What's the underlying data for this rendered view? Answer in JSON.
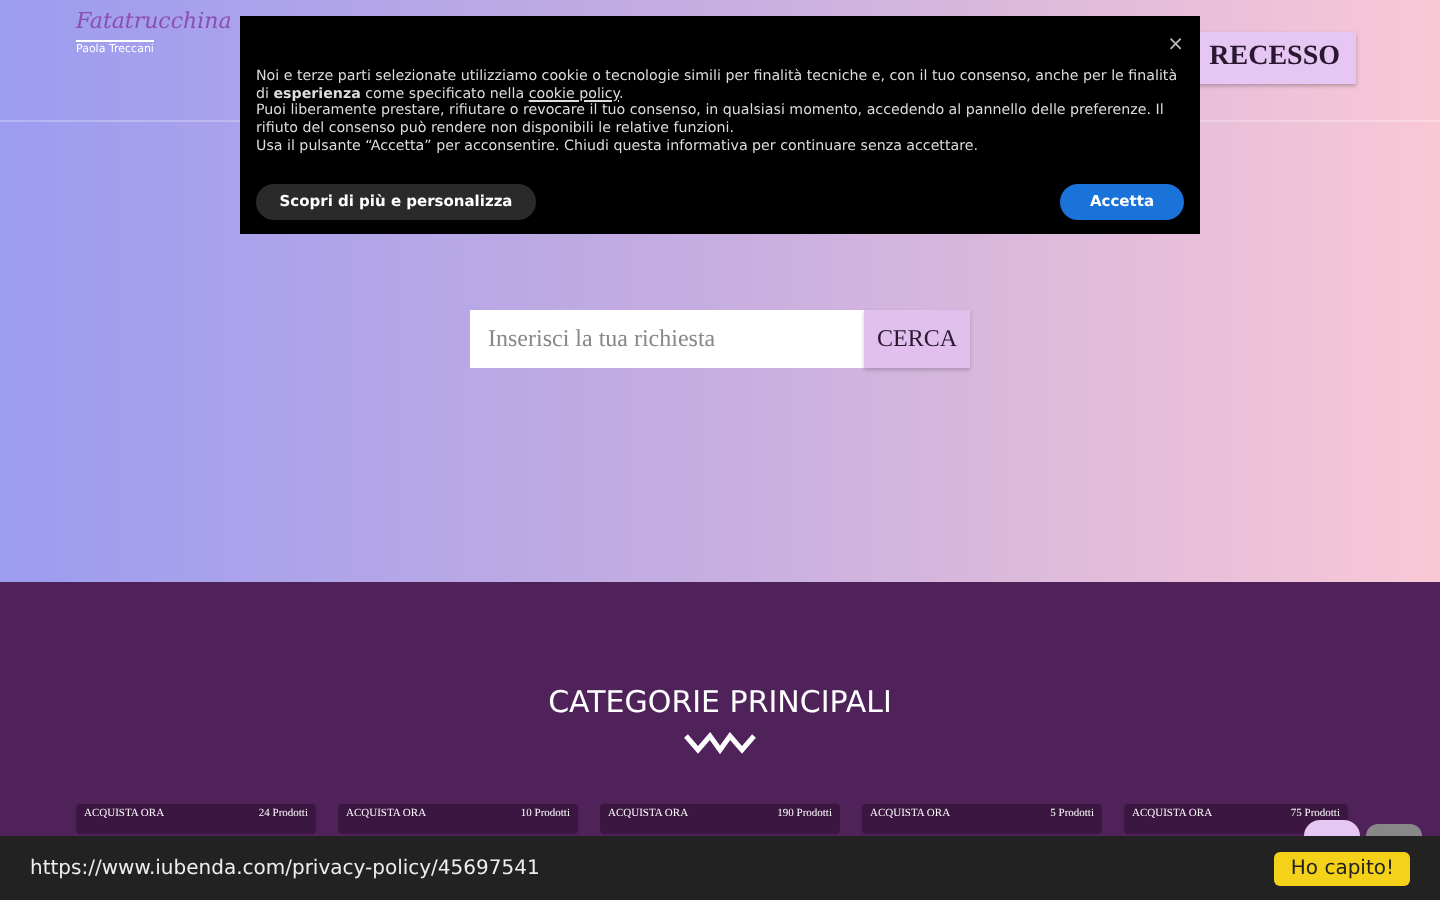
{
  "header": {
    "logo": "Fatatrucchina",
    "logo_subtitle": "Paola Treccani",
    "recesso_button": "RECESSO"
  },
  "cookie_banner": {
    "close": "×",
    "paragraph_1": {
      "before": "Noi e terze parti selezionate utilizziamo cookie o tecnologie simili per finalità tecniche e, con il tuo consenso, anche per le finalità di **esperienza** come specificato nella ",
      "link": "cookie policy",
      "after": "."
    },
    "paragraph_2": "Puoi liberamente prestare, rifiutare o revocare il tuo consenso, in qualsiasi momento, accedendo al pannello delle preferenze. Il rifiuto del consenso può rendere non disponibili le relative funzioni.",
    "paragraph_3": "Usa il pulsante “Accetta” per acconsentire. Chiudi questa informativa per continuare senza accettare.",
    "buttons": [
      {
        "label": "Scopri di più e personalizza",
        "kind": "secondary"
      },
      {
        "label": "Accetta",
        "kind": "primary"
      }
    ]
  },
  "search": {
    "placeholder": "Inserisci la tua richiesta",
    "button": "CERCA"
  },
  "categories": {
    "title": "CATEGORIE PRINCIPALI",
    "cards": [
      {
        "action": "ACQUISTA ORA",
        "count": "24 Prodotti"
      },
      {
        "action": "ACQUISTA ORA",
        "count": "10 Prodotti"
      },
      {
        "action": "ACQUISTA ORA",
        "count": "190 Prodotti"
      },
      {
        "action": "ACQUISTA ORA",
        "count": "5 Prodotti"
      },
      {
        "action": "ACQUISTA ORA",
        "count": "75 Prodotti"
      }
    ]
  },
  "notice_bar": {
    "url": "https://www.iubenda.com/privacy-policy/45697541",
    "button": "Ho capito!"
  }
}
